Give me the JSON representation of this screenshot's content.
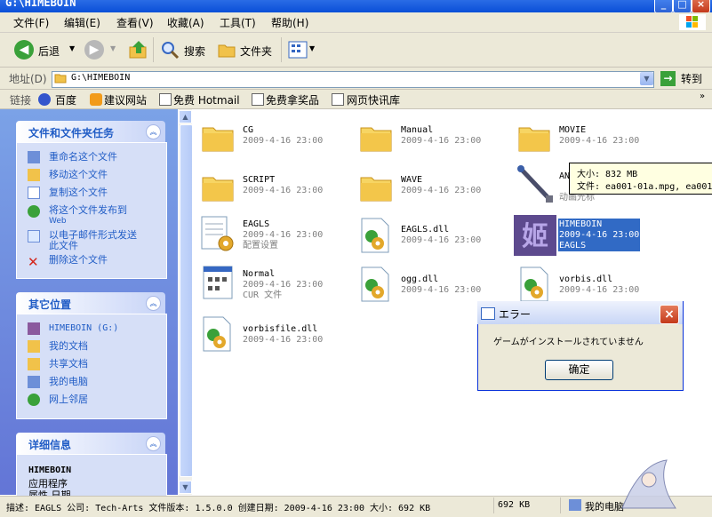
{
  "window": {
    "title": "G:\\HIMEBOIN"
  },
  "menu": [
    "文件(F)",
    "编辑(E)",
    "查看(V)",
    "收藏(A)",
    "工具(T)",
    "帮助(H)"
  ],
  "toolbar": {
    "back": "后退",
    "search": "搜索",
    "folders": "文件夹"
  },
  "address": {
    "label": "地址(D)",
    "value": "G:\\HIMEBOIN",
    "go": "转到"
  },
  "links": {
    "label": "链接",
    "items": [
      "百度",
      "建议网站",
      "免费 Hotmail",
      "免费拿奖品",
      "网页快讯库"
    ]
  },
  "tasks": {
    "title": "文件和文件夹任务",
    "items": [
      "重命名这个文件",
      "移动这个文件",
      "复制这个文件",
      "将这个文件发布到",
      "Web",
      "以电子邮件形式发送",
      "此文件",
      "删除这个文件"
    ]
  },
  "places": {
    "title": "其它位置",
    "items": [
      "HIMEBOIN (G:)",
      "我的文档",
      "共享文档",
      "我的电脑",
      "网上邻居"
    ]
  },
  "details": {
    "title": "详细信息",
    "name": "HIMEBOIN",
    "type": "应用程序",
    "cut": "属性  日期"
  },
  "files": [
    {
      "name": "CG",
      "date": "2009-4-16 23:00"
    },
    {
      "name": "Manual",
      "date": "2009-4-16 23:00"
    },
    {
      "name": "MOVIE",
      "date": "2009-4-16 23:00"
    },
    {
      "name": "SCRIPT",
      "date": "2009-4-16 23:00"
    },
    {
      "name": "WAVE",
      "date": "2009-4-16 23:00"
    },
    {
      "name": "AN",
      "date": "动画光标"
    },
    {
      "name": "EAGLS",
      "date": "2009-4-16 23:00",
      "sub": "配置设置"
    },
    {
      "name": "EAGLS.dll",
      "date": "2009-4-16 23:00"
    },
    {
      "name": "HIMEBOIN",
      "date": "2009-4-16 23:00",
      "sub": "EAGLS"
    },
    {
      "name": "Normal",
      "date": "2009-4-16 23:00",
      "sub": "CUR 文件"
    },
    {
      "name": "ogg.dll",
      "date": "2009-4-16 23:00"
    },
    {
      "name": "vorbis.dll",
      "date": "2009-4-16 23:00"
    },
    {
      "name": "vorbisfile.dll",
      "date": "2009-4-16 23:00"
    }
  ],
  "tooltip": {
    "size": "大小: 832 MB",
    "file": "文件: ea001-01a.mpg, ea001"
  },
  "dialog": {
    "title": "エラー",
    "message": "ゲームがインストールされていません",
    "ok": "确定"
  },
  "status": {
    "desc": "描述: EAGLS 公司: Tech-Arts 文件版本: 1.5.0.0 创建日期: 2009-4-16 23:00 大小: 692 KB",
    "size": "692 KB",
    "computer": "我的电脑"
  },
  "colors": {
    "accent": "#215dc6",
    "titlebar": "#0a4fd8",
    "panel": "#d6dff7",
    "selection": "#316ac5"
  }
}
